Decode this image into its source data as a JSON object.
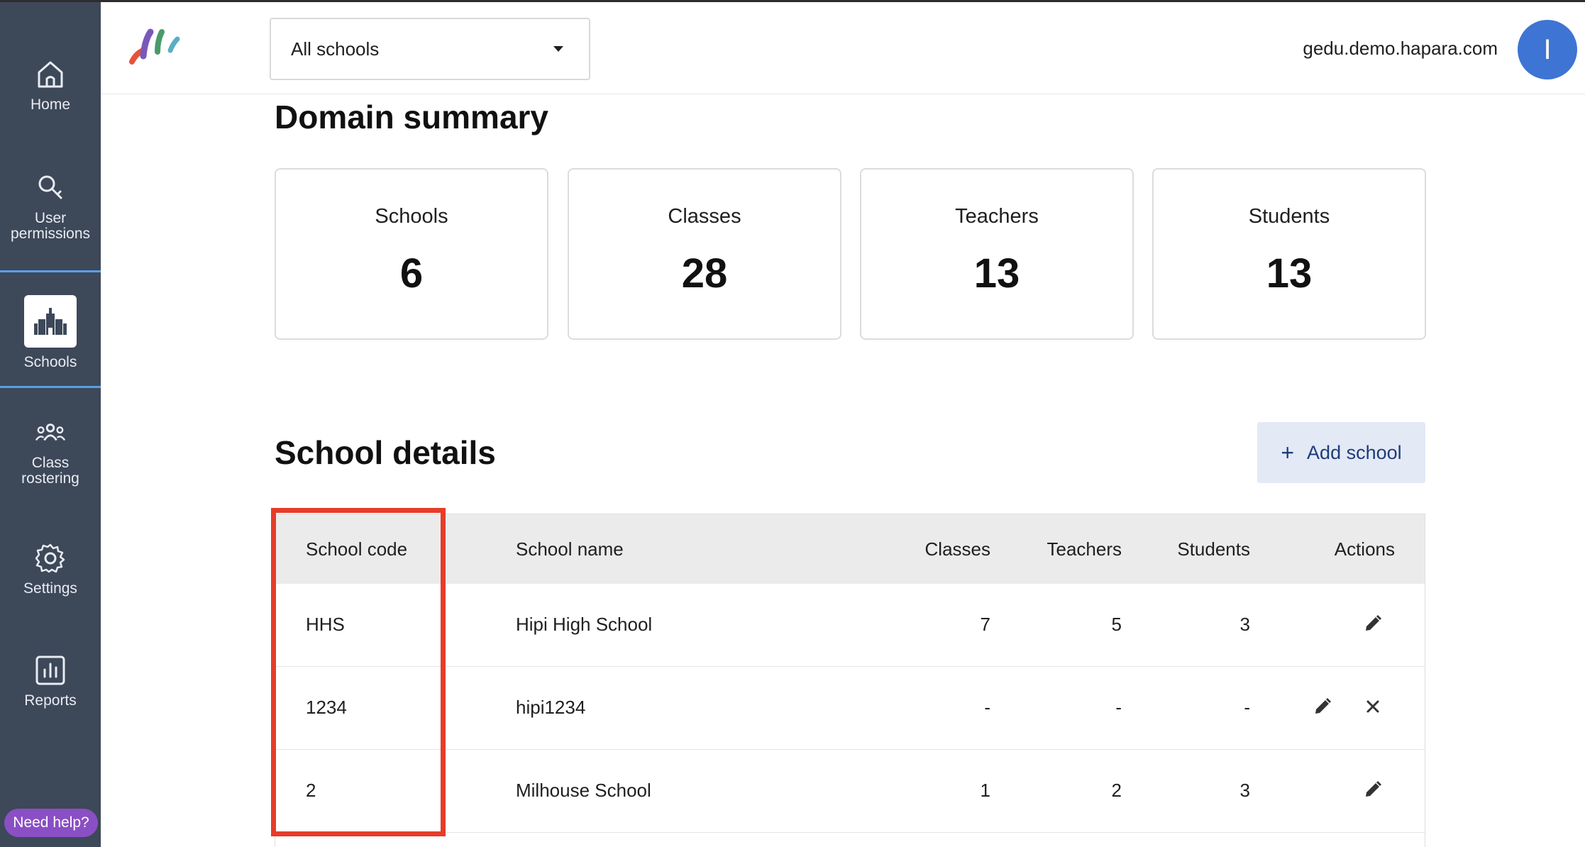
{
  "sidebar": {
    "items": [
      {
        "label": "Home",
        "icon": "home-icon"
      },
      {
        "label": "User permissions",
        "icon": "key-icon"
      },
      {
        "label": "Schools",
        "icon": "school-icon"
      },
      {
        "label": "Class rostering",
        "icon": "people-icon"
      },
      {
        "label": "Settings",
        "icon": "gear-icon"
      },
      {
        "label": "Reports",
        "icon": "bar-chart-icon"
      }
    ],
    "active": "Schools",
    "help_label": "Need help?"
  },
  "header": {
    "school_select": "All schools",
    "domain": "gedu.demo.hapara.com",
    "avatar_initial": "I"
  },
  "summary": {
    "title": "Domain summary",
    "cards": [
      {
        "label": "Schools",
        "value": "6"
      },
      {
        "label": "Classes",
        "value": "28"
      },
      {
        "label": "Teachers",
        "value": "13"
      },
      {
        "label": "Students",
        "value": "13"
      }
    ]
  },
  "details": {
    "title": "School details",
    "add_label": "Add school",
    "columns": [
      "School code",
      "School name",
      "Classes",
      "Teachers",
      "Students",
      "Actions"
    ],
    "rows": [
      {
        "code": "HHS",
        "name": "Hipi High School",
        "classes": "7",
        "teachers": "5",
        "students": "3",
        "actions": [
          "edit"
        ]
      },
      {
        "code": "1234",
        "name": "hipi1234",
        "classes": "-",
        "teachers": "-",
        "students": "-",
        "actions": [
          "edit",
          "delete"
        ]
      },
      {
        "code": "2",
        "name": "Milhouse School",
        "classes": "1",
        "teachers": "2",
        "students": "3",
        "actions": [
          "edit"
        ]
      }
    ]
  },
  "colors": {
    "sidebar": "#3d4859",
    "accent": "#5b9ee6",
    "avatar": "#3e74d3",
    "highlight": "#e53d2a",
    "help": "#8a4fc4"
  }
}
